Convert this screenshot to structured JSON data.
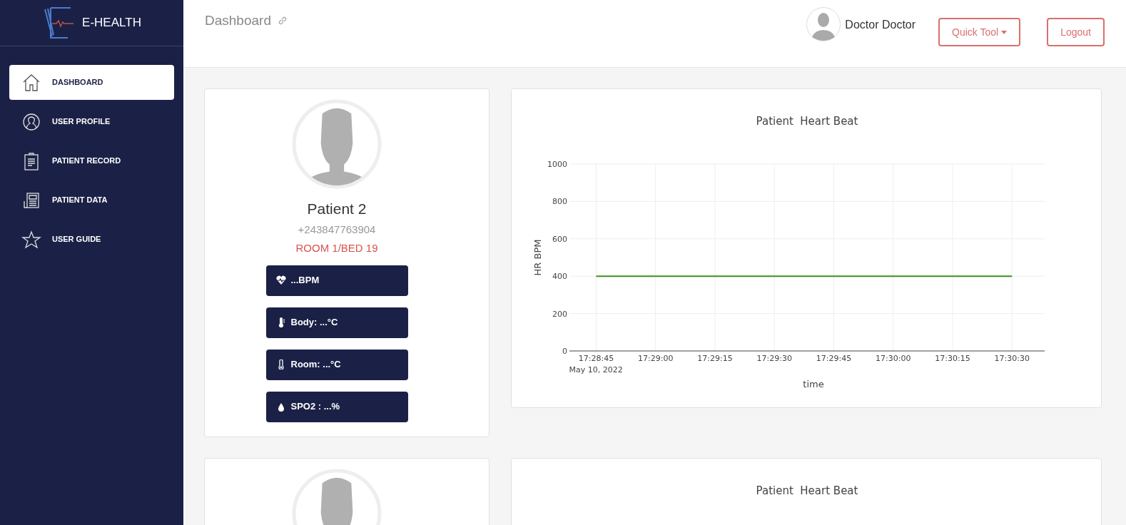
{
  "sidebar": {
    "brand": "E-HEALTH",
    "items": [
      {
        "label": "DASHBOARD",
        "kind": "home",
        "selected": true
      },
      {
        "label": "USER PROFILE",
        "kind": "user",
        "selected": false
      },
      {
        "label": "PATIENT RECORD",
        "kind": "clipboard",
        "selected": false
      },
      {
        "label": "PATIENT DATA",
        "kind": "document",
        "selected": false
      },
      {
        "label": "USER GUIDE",
        "kind": "star",
        "selected": false
      }
    ]
  },
  "header": {
    "title": "Dashboard",
    "user_name": "Doctor Doctor",
    "buttons": [
      {
        "label": "Quick Tool",
        "kind": "dropdown"
      },
      {
        "label": "Logout",
        "kind": "plain"
      }
    ]
  },
  "rows": [
    {
      "patient": {
        "name": "Patient 2",
        "phone": "+243847763904",
        "location": "ROOM 1/BED 19",
        "vitals": [
          {
            "kind": "heart",
            "label": "...BPM"
          },
          {
            "kind": "thermometer",
            "label": "Body: ...°C"
          },
          {
            "kind": "room-thermometer",
            "label": "Room: ...°C"
          },
          {
            "kind": "drop",
            "label": "SPO2 : ...%"
          }
        ]
      },
      "chart": {
        "chart_data": {
          "type": "line",
          "grid": true,
          "title": "Patient  Heart Beat",
          "xlabel": "time",
          "ylabel": "HR BPM",
          "ylim": [
            0,
            1000
          ],
          "yticks": [
            0,
            200,
            400,
            600,
            800,
            1000
          ],
          "categories": [
            "17:28:45",
            "17:29:00",
            "17:29:15",
            "17:29:30",
            "17:29:45",
            "17:30:00",
            "17:30:15",
            "17:30:30"
          ],
          "series": [
            {
              "color": "#3d8f1f",
              "values": [
                400,
                400,
                400,
                400,
                400,
                400,
                400,
                400
              ]
            }
          ],
          "annotations": [
            "May 10, 2022"
          ]
        }
      }
    },
    {
      "patient": {},
      "chart": {
        "title": "Patient  Heart Beat"
      }
    }
  ]
}
